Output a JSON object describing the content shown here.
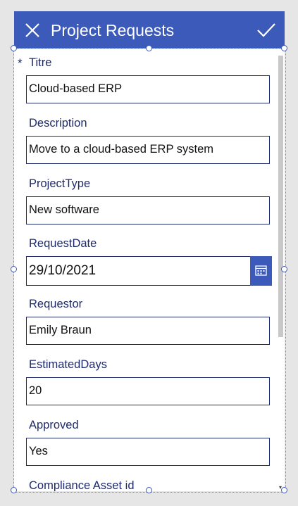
{
  "header": {
    "title": "Project Requests",
    "close_icon": "close-icon",
    "submit_icon": "checkmark-icon",
    "background": "#3c5aba"
  },
  "form": {
    "required_marker": "*",
    "fields": [
      {
        "label": "Titre",
        "value": "Cloud-based ERP",
        "required": true
      },
      {
        "label": "Description",
        "value": "Move to a cloud-based ERP system"
      },
      {
        "label": "ProjectType",
        "value": "New software"
      },
      {
        "label": "RequestDate",
        "value": "29/10/2021",
        "icon": "calendar-icon"
      },
      {
        "label": "Requestor",
        "value": "Emily Braun"
      },
      {
        "label": "EstimatedDays",
        "value": "20"
      },
      {
        "label": "Approved",
        "value": "Yes"
      },
      {
        "label": "Compliance Asset id"
      }
    ]
  },
  "colors": {
    "accent": "#3c5aba",
    "label": "#1f2a6b",
    "input_border": "#1f2a6b"
  }
}
